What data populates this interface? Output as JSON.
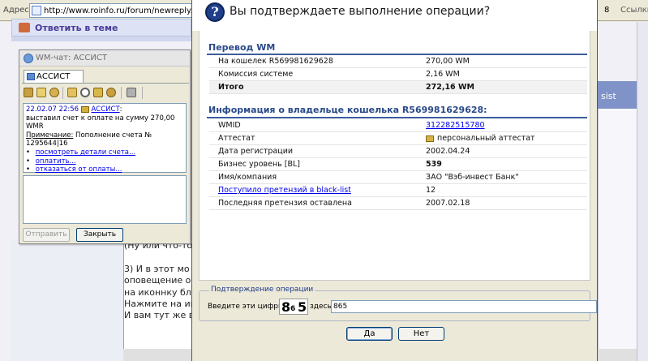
{
  "browser": {
    "address_label": "Адрес:",
    "url": "http://www.roinfo.ru/forum/newreply.php",
    "right_count": "8",
    "right_links": "Ссылки",
    "reply_link": "Ответить в теме",
    "right_tab_label": "sist",
    "editor_lines": [
      "(Ну или что-то",
      "",
      "3) И в этот мо",
      "оповещение о",
      "на иконнку бл",
      "Нажмите на ик",
      "И вам тут же в"
    ]
  },
  "chat": {
    "window_title": "WM-чат: АССИСТ",
    "tab_label": "АССИСТ",
    "message": {
      "time": "22.02.07 22:56",
      "user": "АССИСТ",
      "text": "выставил счет к оплате на сумму 270,00 WMR",
      "note_label": "Примечание:",
      "note_text": " Пополнение счета № 1295644|16",
      "links": [
        "посмотреть детали счета...",
        "оплатить...",
        "отказаться от оплаты..."
      ]
    },
    "send_button": "Отправить",
    "close_button": "Закрыть"
  },
  "dialog": {
    "question": "Вы подтверждаете выполнение операции?",
    "transfer": {
      "title": "Перевод WM",
      "rows": [
        {
          "label": "На кошелек R569981629628",
          "value": "270,00 WM"
        },
        {
          "label": "Комиссия системе",
          "value": "2,16 WM"
        },
        {
          "label": "Итого",
          "value": "272,16 WM"
        }
      ]
    },
    "owner": {
      "title": "Информация о владельце кошелька R569981629628:",
      "rows": [
        {
          "label": "WMID",
          "value": "312282515780"
        },
        {
          "label": "Аттестат",
          "value": "персональный аттестат"
        },
        {
          "label": "Дата регистрации",
          "value": "2002.04.24"
        },
        {
          "label": "Бизнес уровень [BL]",
          "value": "539"
        },
        {
          "label": "Имя/компания",
          "value": "ЗАО \"Вэб-инвест Банк\""
        },
        {
          "label": "Поступило претензий в black-list",
          "value": "12"
        },
        {
          "label": "Последняя претензия оставлена",
          "value": "2007.02.18"
        }
      ]
    },
    "confirm": {
      "legend": "Подтверждение операции",
      "label": "Введите эти цифры",
      "captcha_digits": [
        "8",
        "6",
        "5"
      ],
      "here": "здесь",
      "input_value": "865"
    },
    "yes_button": "Да",
    "no_button": "Нет"
  }
}
